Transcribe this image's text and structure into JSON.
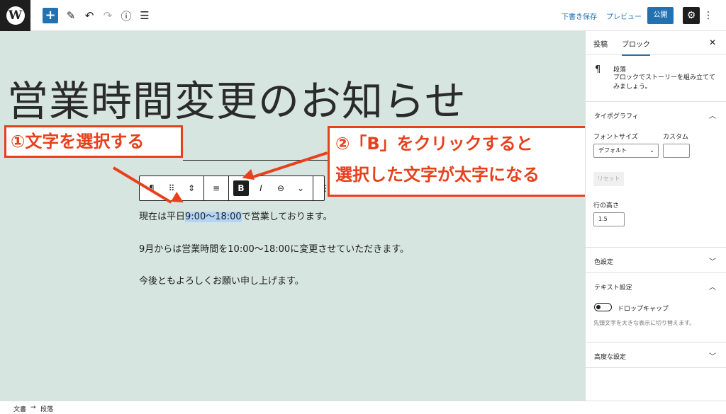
{
  "toolbar": {
    "add_label": "+",
    "preview_draft": "下書き保存",
    "preview": "プレビュー",
    "publish": "公開"
  },
  "post": {
    "title": "営業時間変更のお知らせ",
    "paragraph1_before": "現在は平日",
    "paragraph1_selected": "9:00〜18:00",
    "paragraph1_after": "で営業しております。",
    "paragraph2": "9月からは営業時間を10:00〜18:00に変更させていただきます。",
    "paragraph3": "今後ともよろしくお願い申し上げます。"
  },
  "block_toolbar": {
    "bold": "B",
    "italic": "I"
  },
  "annotations": {
    "callout1": "①文字を選択する",
    "callout2_line1": "②「B」をクリックすると",
    "callout2_line2": "選択した文字が太字になる",
    "accent": "#e8401c"
  },
  "sidebar": {
    "tab_post": "投稿",
    "tab_block": "ブロック",
    "block_name": "段落",
    "block_desc": "ブロックでストーリーを組み立ててみましょう。",
    "typography": "タイポグラフィ",
    "font_size": "フォントサイズ",
    "custom": "カスタム",
    "font_default": "デフォルト",
    "reset": "リセット",
    "line_height": "行の高さ",
    "line_height_value": "1.5",
    "color_settings": "色設定",
    "text_settings": "テキスト設定",
    "drop_cap": "ドロップキャップ",
    "drop_cap_help": "先頭文字を大きな表示に切り替えます。",
    "advanced": "高度な設定"
  },
  "footer": {
    "breadcrumb_doc": "文書",
    "breadcrumb_arrow": "→",
    "breadcrumb_block": "段落"
  }
}
